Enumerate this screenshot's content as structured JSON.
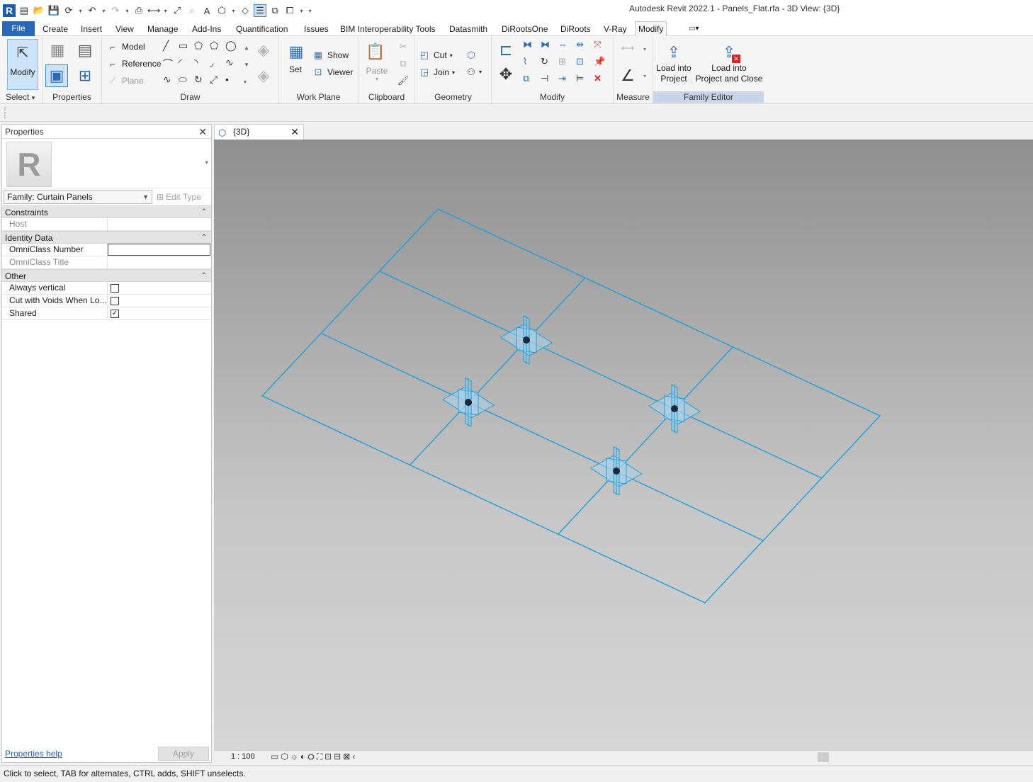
{
  "window": {
    "title": "Autodesk Revit 2022.1 - Panels_Flat.rfa - 3D View: {3D}"
  },
  "qat": {
    "icons": [
      "revit-logo",
      "open",
      "save",
      "sync",
      "undo",
      "redo",
      "print",
      "measure",
      "dimension",
      "tag",
      "text",
      "3d-view",
      "section",
      "thin-lines",
      "close-hidden",
      "switch-windows",
      "customize"
    ]
  },
  "ribbon": {
    "tabs": [
      {
        "label": "File"
      },
      {
        "label": "Create"
      },
      {
        "label": "Insert"
      },
      {
        "label": "View"
      },
      {
        "label": "Manage"
      },
      {
        "label": "Add-Ins"
      },
      {
        "label": "Quantification"
      },
      {
        "label": "Issues"
      },
      {
        "label": "BIM Interoperability Tools"
      },
      {
        "label": "Datasmith"
      },
      {
        "label": "DiRootsOne"
      },
      {
        "label": "DiRoots"
      },
      {
        "label": "V-Ray"
      },
      {
        "label": "Modify"
      }
    ],
    "active_tab": "Modify",
    "select_panel": {
      "modify_label": "Modify",
      "label": "Select"
    },
    "properties_panel": {
      "label": "Properties"
    },
    "draw_panel": {
      "label": "Draw",
      "model_label": "Model",
      "reference_label": "Reference",
      "plane_label": "Plane"
    },
    "workplane_panel": {
      "label": "Work Plane",
      "set_label": "Set",
      "show_label": "Show",
      "viewer_label": "Viewer"
    },
    "clipboard_panel": {
      "label": "Clipboard",
      "paste_label": "Paste"
    },
    "geometry_panel": {
      "label": "Geometry",
      "cut_label": "Cut",
      "join_label": "Join"
    },
    "modify_panel": {
      "label": "Modify"
    },
    "measure_panel": {
      "label": "Measure"
    },
    "family_editor_panel": {
      "label": "Family Editor",
      "load_project_line1": "Load into",
      "load_project_line2": "Project",
      "load_close_line1": "Load into",
      "load_close_line2": "Project and Close"
    }
  },
  "properties": {
    "title": "Properties",
    "family_select": "Family: Curtain Panels",
    "edit_type_label": "Edit Type",
    "groups": {
      "constraints": {
        "label": "Constraints",
        "rows": [
          {
            "name": "Host",
            "value": ""
          }
        ]
      },
      "identity": {
        "label": "Identity Data",
        "rows": [
          {
            "name": "OmniClass Number",
            "value": ""
          },
          {
            "name": "OmniClass Title",
            "value": ""
          }
        ]
      },
      "other": {
        "label": "Other",
        "rows": [
          {
            "name": "Always vertical",
            "checked": false
          },
          {
            "name": "Cut with Voids When Lo...",
            "checked": false
          },
          {
            "name": "Shared",
            "checked": true
          }
        ]
      }
    },
    "help_link": "Properties help",
    "apply_label": "Apply"
  },
  "view": {
    "tab_label": "{3D}",
    "scale": "1 : 100",
    "wire_color": "#1e9fd8",
    "background_top": "#8f8f8f",
    "background_bottom": "#d6d6d6"
  },
  "status": {
    "text": "Click to select, TAB for alternates, CTRL adds, SHIFT unselects."
  }
}
